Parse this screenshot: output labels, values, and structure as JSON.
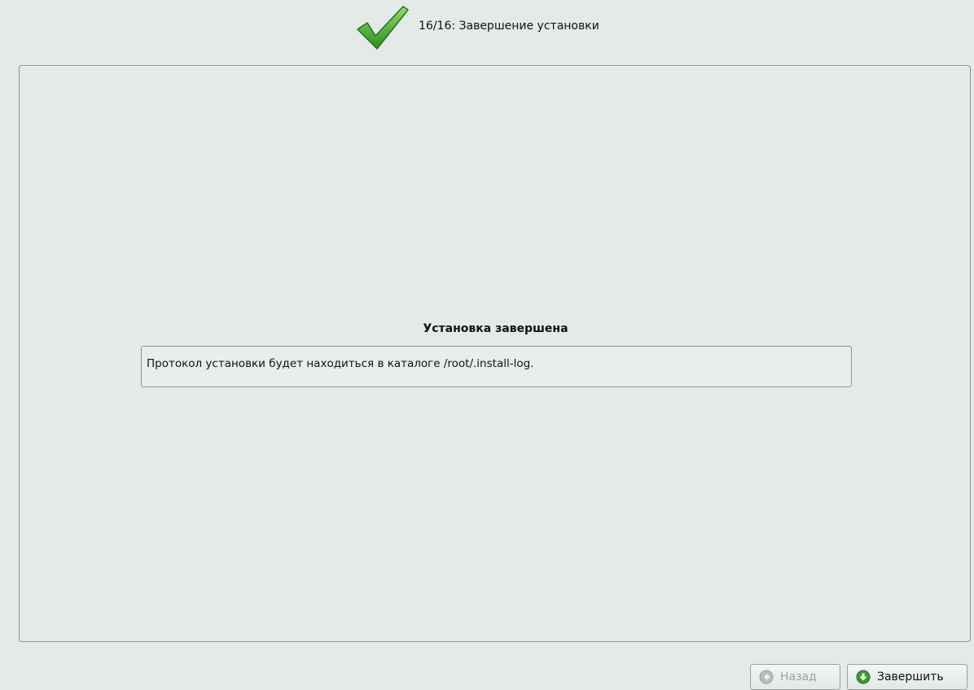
{
  "header": {
    "icon": "checkmark-icon",
    "step_title": "16/16: Завершение установки"
  },
  "main": {
    "result_heading": "Установка завершена",
    "message": "Протокол установки будет находиться в каталоге /root/.install-log."
  },
  "buttons": {
    "back_label": "Назад",
    "back_icon": "arrow-left-icon",
    "back_enabled": false,
    "finish_label": "Завершить",
    "finish_icon": "arrow-down-icon"
  },
  "colors": {
    "background": "#e4eae8",
    "accent_green": "#3d9a2a",
    "disabled_text": "#9aa0a0"
  }
}
